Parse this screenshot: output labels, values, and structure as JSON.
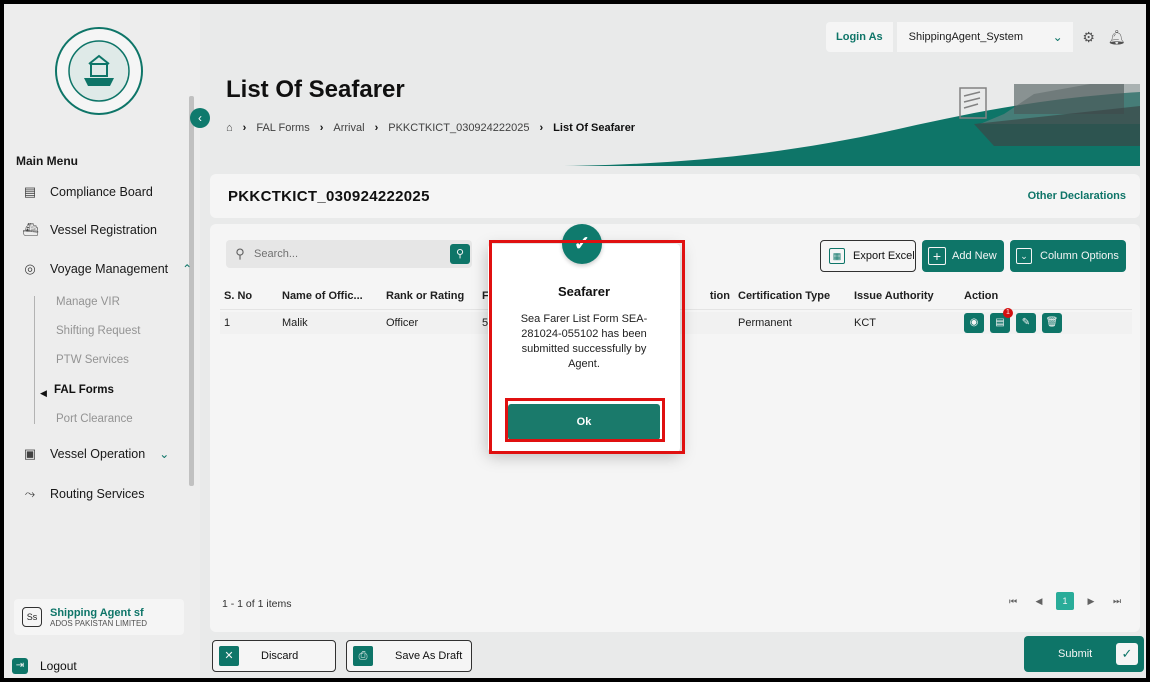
{
  "sidebar": {
    "main_menu_title": "Main Menu",
    "items": [
      {
        "label": "Compliance Board",
        "icon": "clipboard-icon"
      },
      {
        "label": "Vessel Registration",
        "icon": "ship-icon"
      },
      {
        "label": "Voyage Management",
        "icon": "compass-icon",
        "expanded": true
      },
      {
        "label": "Vessel Operation",
        "icon": "vessel-icon",
        "expanded": false
      },
      {
        "label": "Routing Services",
        "icon": "route-icon"
      }
    ],
    "sub_items": [
      "Manage VIR",
      "Shifting Request",
      "PTW Services",
      "FAL Forms",
      "Port Clearance"
    ],
    "active_sub_item": "FAL Forms",
    "user": {
      "initials": "Ss",
      "name": "Shipping Agent sf",
      "org": "ADOS PAKISTAN LIMITED"
    },
    "logout_label": "Logout"
  },
  "topbar": {
    "login_as_label": "Login As",
    "login_as_value": "ShippingAgent_System"
  },
  "header": {
    "title": "List Of Seafarer",
    "breadcrumb": [
      "FAL Forms",
      "Arrival",
      "PKKCTKICT_030924222025",
      "List Of Seafarer"
    ]
  },
  "declaration": {
    "title": "PKKCTKICT_030924222025",
    "other_link": "Other Declarations"
  },
  "toolbar": {
    "search_placeholder": "Search...",
    "export_label": "Export Excel",
    "add_label": "Add New",
    "column_label": "Column Options"
  },
  "table": {
    "headers": [
      "S. No",
      "Name of Offic...",
      "Rank or Rating",
      "F",
      "tion",
      "Certification Type",
      "Issue Authority",
      "Action"
    ],
    "rows": [
      {
        "sno": "1",
        "name": "Malik",
        "rank": "Officer",
        "f": "5",
        "cert_type": "Permanent",
        "authority": "KCT",
        "badge": "1"
      }
    ],
    "items_count": "1 - 1 of 1 items",
    "page": "1"
  },
  "footer": {
    "discard_label": "Discard",
    "save_draft_label": "Save As Draft",
    "submit_label": "Submit"
  },
  "modal": {
    "title": "Seafarer",
    "message": "Sea Farer List Form SEA-281024-055102 has been submitted successfully by Agent.",
    "ok_label": "Ok"
  },
  "colors": {
    "accent": "#0f7a6d",
    "highlight": "#e01010"
  }
}
